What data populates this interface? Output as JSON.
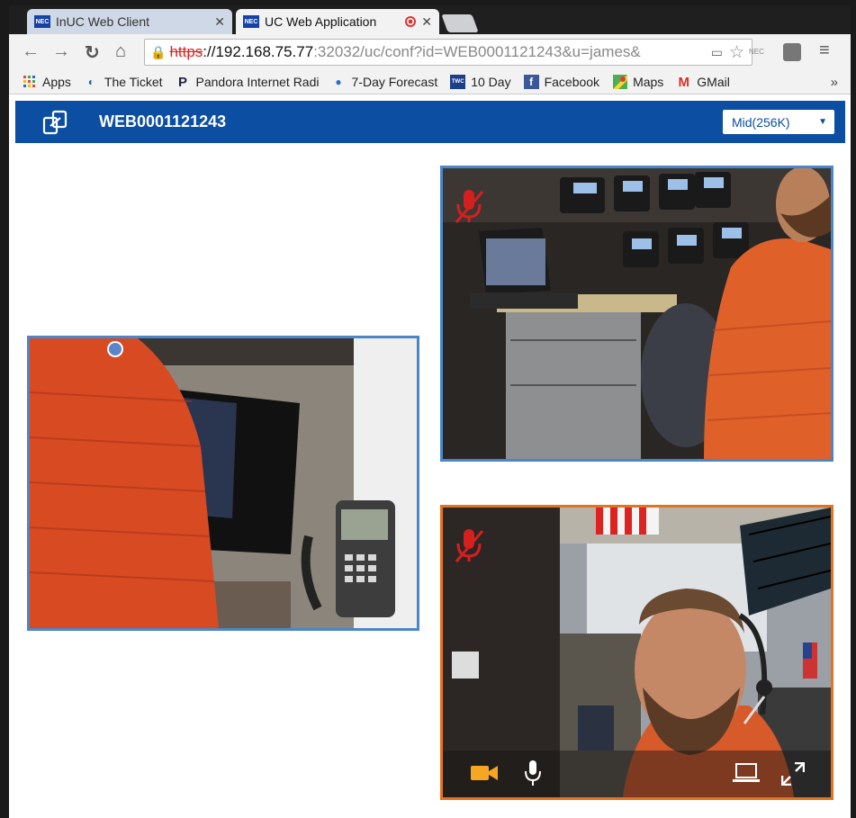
{
  "tabs": [
    {
      "title": "InUC Web Client",
      "favicon": "NEC",
      "active": false
    },
    {
      "title": "UC Web Application",
      "favicon": "NEC",
      "active": true
    }
  ],
  "address_bar": {
    "scheme": "https",
    "host": "://192.168.75.77",
    "path": ":32032/uc/conf?id=WEB0001121243&u=james&"
  },
  "bookmarks": [
    {
      "label": "Apps",
      "icon": "apps-grid-icon"
    },
    {
      "label": "The Ticket",
      "icon": "ticket-icon"
    },
    {
      "label": "Pandora Internet Radi",
      "icon": "pandora-p-icon"
    },
    {
      "label": "7-Day Forecast",
      "icon": "noaa-icon"
    },
    {
      "label": "10 Day",
      "icon": "weather-channel-icon"
    },
    {
      "label": "Facebook",
      "icon": "facebook-icon"
    },
    {
      "label": "Maps",
      "icon": "maps-icon"
    },
    {
      "label": "GMail",
      "icon": "gmail-icon"
    }
  ],
  "bookmarks_overflow": "»",
  "app": {
    "conference_id": "WEB0001121243",
    "bandwidth": "Mid(256K)",
    "colors": {
      "header": "#0b4ea2",
      "remote_border": "#4a86c8",
      "self_border": "#e2731f",
      "muted": "#d61f1f",
      "active_control": "#f5a623"
    }
  },
  "participants": [
    {
      "id": "left",
      "muted": false
    },
    {
      "id": "top-right",
      "muted": true
    },
    {
      "id": "self",
      "muted": true
    }
  ],
  "controls": [
    {
      "name": "camera",
      "icon": "camera-icon",
      "active": true
    },
    {
      "name": "microphone",
      "icon": "microphone-icon",
      "active": false
    },
    {
      "name": "share-screen",
      "icon": "laptop-icon",
      "active": false
    },
    {
      "name": "fullscreen",
      "icon": "expand-icon",
      "active": false
    }
  ]
}
